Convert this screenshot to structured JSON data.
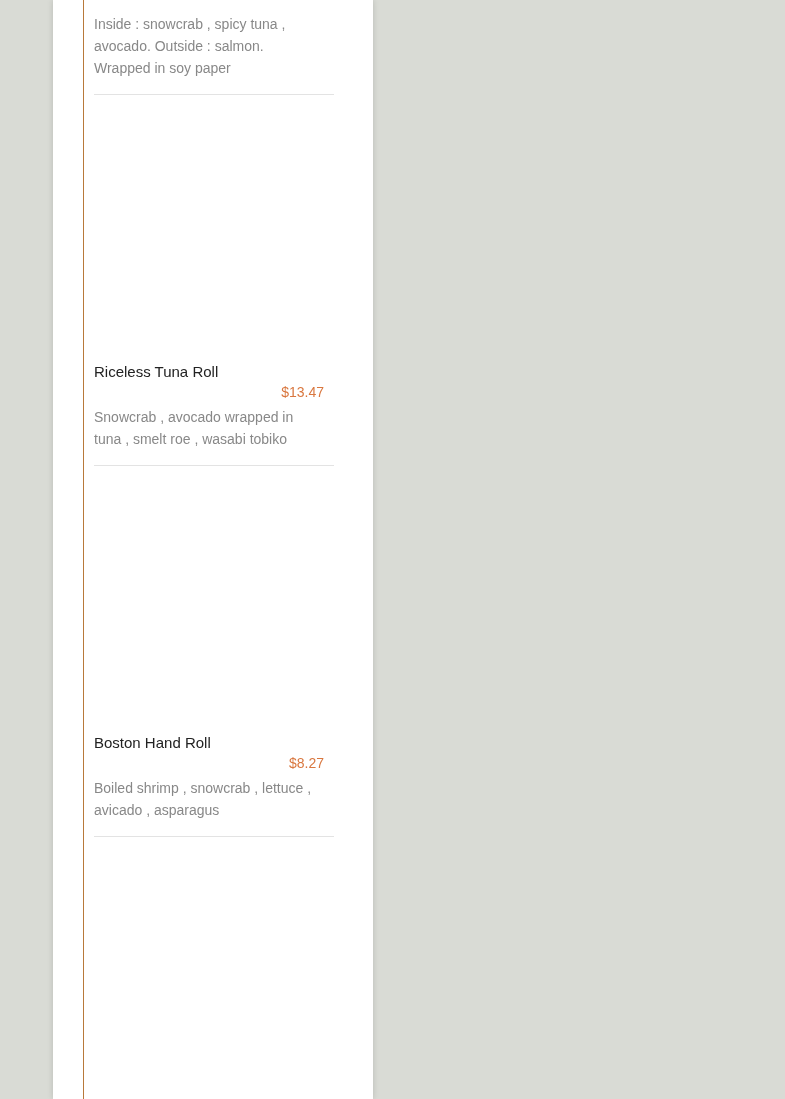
{
  "menu_items": [
    {
      "description": "Inside : snowcrab , spicy tuna , avocado. Outside : salmon. Wrapped in soy paper"
    },
    {
      "name": "Riceless Tuna Roll",
      "price": "$13.47",
      "description": "Snowcrab , avocado wrapped in tuna , smelt roe , wasabi tobiko"
    },
    {
      "name": "Boston Hand Roll",
      "price": "$8.27",
      "description": "Boiled shrimp , snowcrab , lettuce , avicado , asparagus"
    }
  ]
}
